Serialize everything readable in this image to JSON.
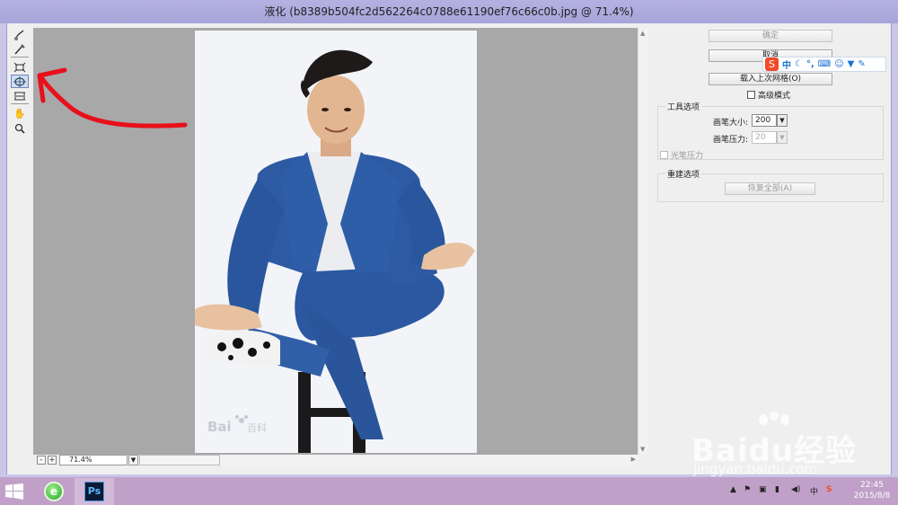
{
  "window": {
    "title": "液化 (b8389b504fc2d562264c0788e61190ef76c66c0b.jpg @ 71.4%)"
  },
  "toolbar": {
    "tools": [
      "forward-warp-tool",
      "reconstruct-tool",
      "pucker-tool",
      "bloat-tool",
      "push-left-tool",
      "hand-tool",
      "zoom-tool"
    ],
    "active_tool": "bloat-tool"
  },
  "canvas": {
    "photo_watermark": "Bai",
    "photo_watermark_2": "百科"
  },
  "zoom": {
    "minus": "-",
    "plus": "+",
    "value": "71.4%"
  },
  "buttons": {
    "ok": "确定",
    "cancel": "取消",
    "load_mesh": "载入上次网格(O)",
    "advanced_mode": "高级模式"
  },
  "tool_options": {
    "title": "工具选项",
    "brush_size_label": "画笔大小:",
    "brush_size_value": "200",
    "brush_pressure_label": "画笔压力:",
    "brush_pressure_value": "20",
    "stylus_pressure": "光笔压力"
  },
  "reconstruct_options": {
    "title": "重建选项",
    "restore_all": "恢复全部(A)"
  },
  "ime": {
    "logo": "S",
    "lang": "中"
  },
  "taskbar": {
    "apps": [
      "ie-browser",
      "photoshop"
    ],
    "ps_label": "Ps",
    "ime_indicator": "中",
    "time": "22:45",
    "date": "2015/8/8"
  },
  "watermark": {
    "text": "Baidu经验",
    "url": "jingyan.baidu.com"
  },
  "colors": {
    "annotation_arrow": "#e8101a",
    "active_tool_bg": "#cfdcf4",
    "suit": "#2d5aa3"
  }
}
